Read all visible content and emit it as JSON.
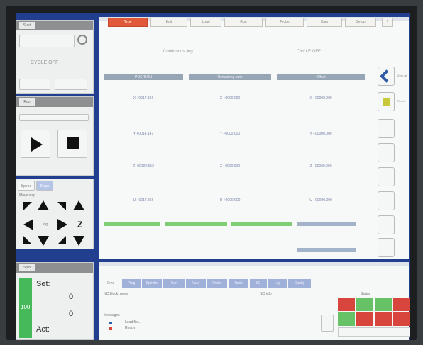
{
  "power": {
    "status": "CYCLE OFF",
    "icon": "power-icon"
  },
  "jog": {
    "tab1": "Speed",
    "tab2": "Steps",
    "increment_label": "Move step",
    "center_label": "Jog",
    "z_label": "Z"
  },
  "spindle": {
    "value": "100",
    "set_label": "Set:",
    "set_value": "0",
    "act_label": "Act:",
    "act_value": "0"
  },
  "toolbar": {
    "items": [
      "Type",
      "Edit",
      "Load",
      "Run",
      "Probe",
      "Cam",
      "Setup",
      "Help"
    ],
    "help_icon": "?"
  },
  "dro": {
    "mode": "Continuous Jog",
    "cycle": "CYCLE OFF",
    "columns": [
      {
        "header": "POSITION",
        "values": [
          "X +0017.866",
          "Y +0014.147",
          "Z -00104.552",
          "U +0017.866"
        ]
      },
      {
        "header": "Remaining path",
        "values": [
          "X +0000.000",
          "Y +0000.000",
          "Z +0000.000",
          "U +0000.000"
        ]
      },
      {
        "header": "Offset",
        "values": [
          "X +00000.000",
          "Y +00000.000",
          "Z +00000.000",
          "U +00000.000"
        ]
      }
    ]
  },
  "side": {
    "zero_label": "Zero all",
    "reset_label": "Reset"
  },
  "bottom_tabs": [
    "Cmd",
    "Prog",
    "Spindle",
    "Tool",
    "Vars",
    "Probe",
    "Tools",
    "I/O",
    "Log",
    "Config"
  ],
  "bottom": {
    "section1": "NC block: none",
    "section2": "Messages",
    "section3": "NC info",
    "section4": "Status",
    "line1": "Load file...",
    "line2": "Ready"
  }
}
